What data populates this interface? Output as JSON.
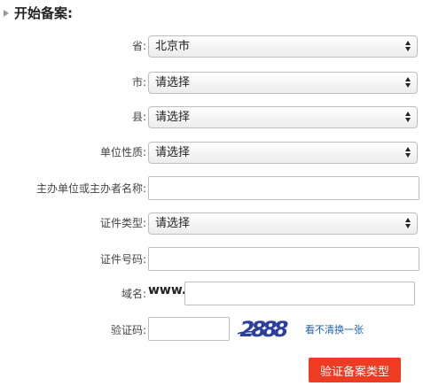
{
  "header": {
    "title": "开始备案:"
  },
  "form": {
    "province": {
      "label": "省:",
      "value": "北京市"
    },
    "city": {
      "label": "市:",
      "value": "请选择"
    },
    "county": {
      "label": "县:",
      "value": "请选择"
    },
    "unit_type": {
      "label": "单位性质:",
      "value": "请选择"
    },
    "sponsor_name": {
      "label": "主办单位或主办者名称:",
      "value": ""
    },
    "id_type": {
      "label": "证件类型:",
      "value": "请选择"
    },
    "id_number": {
      "label": "证件号码:",
      "value": ""
    },
    "domain": {
      "label": "域名:",
      "prefix": "www.",
      "value": ""
    },
    "captcha": {
      "label": "验证码:",
      "value": "",
      "image_text": "2888",
      "refresh_link": "看不清换一张"
    },
    "submit_label": "验证备案类型"
  },
  "colors": {
    "submit": "#ef3b22",
    "link": "#1a5fb4",
    "captcha": "#2a3fa0"
  }
}
